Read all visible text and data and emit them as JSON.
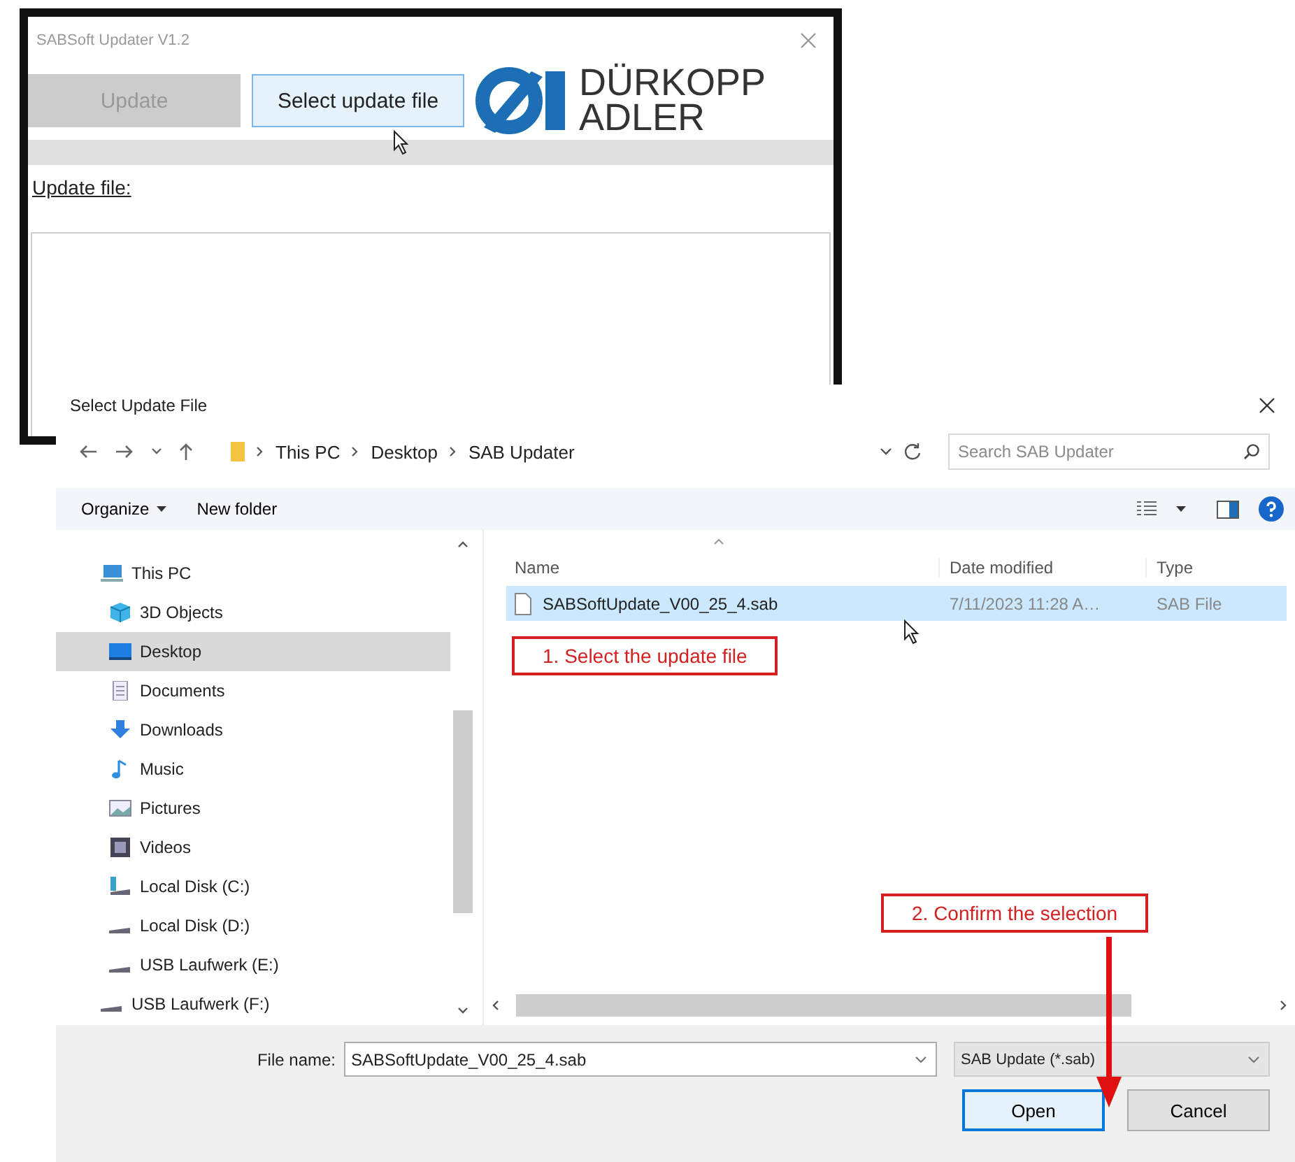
{
  "app_window": {
    "title": "SABSoft Updater V1.2",
    "update_button": {
      "label": "Update",
      "disabled": true
    },
    "select_button": {
      "label": "Select update file",
      "hovered": true
    },
    "logo": {
      "line_1": "DÜRKOPP",
      "line_2": "ADLER"
    },
    "update_file_label": "Update file:"
  },
  "dialog": {
    "title": "Select Update File",
    "breadcrumb": [
      "This PC",
      "Desktop",
      "SAB Updater"
    ],
    "search": {
      "placeholder": "Search SAB Updater"
    },
    "toolbar": {
      "organize": "Organize",
      "new_folder": "New folder"
    },
    "sidebar": {
      "items": [
        {
          "label": "This PC",
          "kind": "pc",
          "selected": false,
          "children": [
            {
              "label": "3D Objects",
              "kind": "cube",
              "selected": false
            },
            {
              "label": "Desktop",
              "kind": "desktop",
              "selected": true
            },
            {
              "label": "Documents",
              "kind": "documents",
              "selected": false
            },
            {
              "label": "Downloads",
              "kind": "downloads",
              "selected": false
            },
            {
              "label": "Music",
              "kind": "music",
              "selected": false
            },
            {
              "label": "Pictures",
              "kind": "pictures",
              "selected": false
            },
            {
              "label": "Videos",
              "kind": "videos",
              "selected": false
            },
            {
              "label": "Local Disk (C:)",
              "kind": "system-disk",
              "selected": false
            },
            {
              "label": "Local Disk (D:)",
              "kind": "drive",
              "selected": false
            },
            {
              "label": "USB Laufwerk (E:)",
              "kind": "drive",
              "selected": false
            }
          ]
        },
        {
          "label": "USB Laufwerk (F:)",
          "kind": "drive",
          "selected": false
        }
      ]
    },
    "table": {
      "columns": [
        "Name",
        "Date modified",
        "Type"
      ],
      "rows": [
        {
          "name": "SABSoftUpdate_V00_25_4.sab",
          "date_modified": "7/11/2023 11:28 A…",
          "type": "SAB File",
          "selected": true
        }
      ]
    },
    "annotations": [
      {
        "text": "1. Select the update file"
      },
      {
        "text": "2. Confirm the selection"
      }
    ],
    "file_name": {
      "label": "File name:",
      "value": "SABSoftUpdate_V00_25_4.sab"
    },
    "file_type": "SAB Update (*.sab)",
    "buttons": [
      {
        "label": "Open",
        "default": true
      },
      {
        "label": "Cancel",
        "default": false
      }
    ]
  }
}
